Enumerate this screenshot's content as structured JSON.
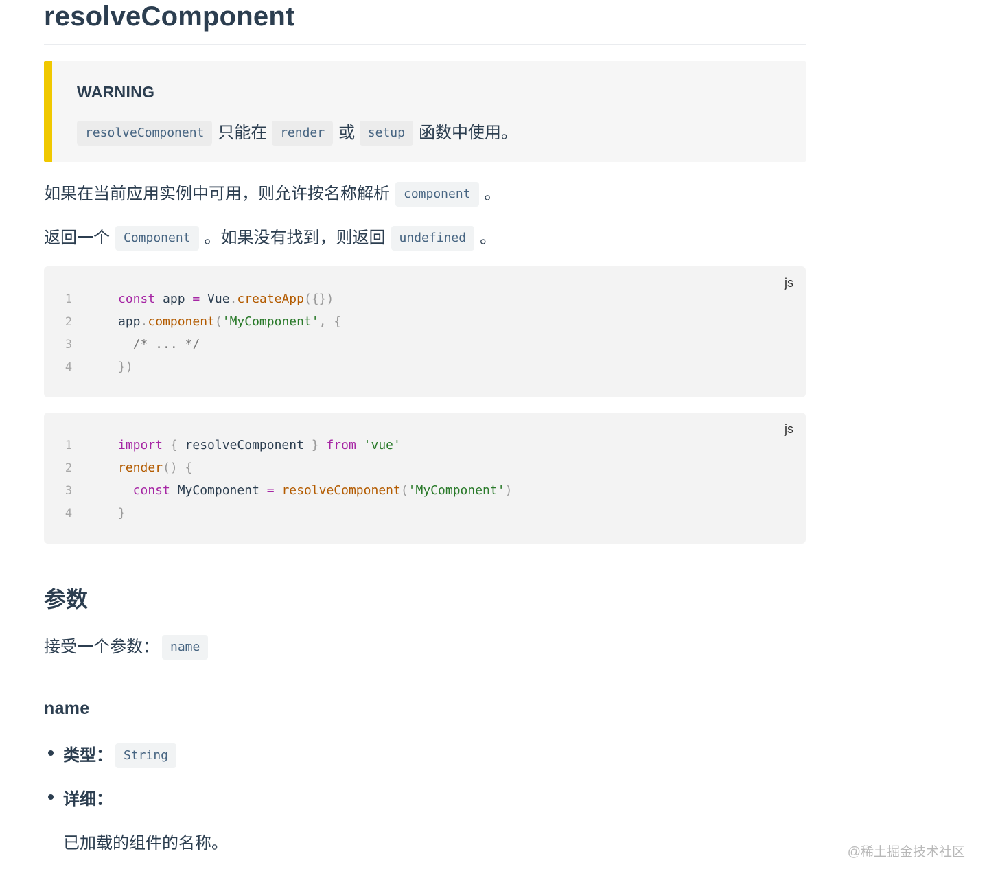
{
  "page": {
    "title": "resolveComponent",
    "warning": {
      "title": "WARNING",
      "code1": "resolveComponent",
      "text1": "只能在",
      "code2": "render",
      "text2": "或",
      "code3": "setup",
      "text3": "函数中使用。"
    },
    "para1": {
      "text": "如果在当前应用实例中可用，则允许按名称解析",
      "code": "component",
      "end": "。"
    },
    "para2": {
      "text1": "返回一个",
      "code1": "Component",
      "text2": "。如果没有找到，则返回",
      "code2": "undefined",
      "end": "。"
    },
    "code_blocks": [
      {
        "lang": "js",
        "line_numbers": [
          "1",
          "2",
          "3",
          "4"
        ]
      },
      {
        "lang": "js",
        "line_numbers": [
          "1",
          "2",
          "3",
          "4"
        ]
      }
    ],
    "params_heading": "参数",
    "params_text": "接受一个参数：",
    "params_code": "name",
    "name_heading": "name",
    "type_label": "类型：",
    "type_code": "String",
    "detail_label": "详细：",
    "detail_text": "已加载的组件的名称。",
    "watermark": "@稀土掘金技术社区"
  },
  "code_text": {
    "b1l1": [
      "const",
      " app ",
      "=",
      " Vue",
      ".",
      "createApp",
      "({})"
    ],
    "b1l2": [
      "app",
      ".",
      "component",
      "(",
      "'MyComponent'",
      ",",
      " {"
    ],
    "b1l3": "  /* ... */",
    "b1l4": "})",
    "b2l1": [
      "import",
      " { ",
      "resolveComponent",
      " } ",
      "from",
      " ",
      "'vue'"
    ],
    "b2l2": [
      "render",
      "()",
      " {"
    ],
    "b2l3": [
      "  const",
      " MyComponent ",
      "=",
      " ",
      "resolveComponent",
      "(",
      "'MyComponent'",
      ")"
    ],
    "b2l4": "}"
  },
  "colors": {
    "warning_bar": "#f0c800",
    "text": "#2c3e50",
    "inline_code": "#476582"
  }
}
